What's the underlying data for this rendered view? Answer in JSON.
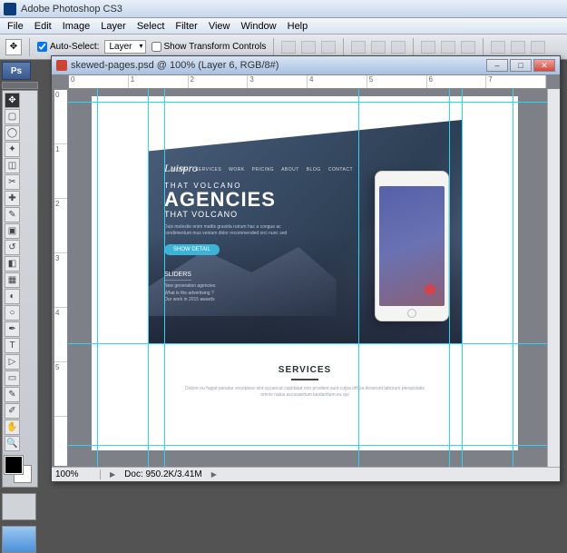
{
  "app": {
    "title": "Adobe Photoshop CS3"
  },
  "menu": [
    "File",
    "Edit",
    "Image",
    "Layer",
    "Select",
    "Filter",
    "View",
    "Window",
    "Help"
  ],
  "options": {
    "auto_select": "Auto-Select:",
    "auto_select_value": "Layer",
    "show_transform": "Show Transform Controls"
  },
  "doc": {
    "title": "skewed-pages.psd @ 100% (Layer 6, RGB/8#)",
    "zoom": "100%",
    "docsize": "Doc: 950.2K/3.41M"
  },
  "ruler_h": [
    "0",
    "1",
    "2",
    "3",
    "4",
    "5",
    "6",
    "7"
  ],
  "ruler_v": [
    "0",
    "1",
    "2",
    "3",
    "4",
    "5"
  ],
  "design": {
    "logo": "Luispro",
    "nav": [
      "HOME",
      "SERVICES",
      "WORK",
      "PRICING",
      "ABOUT",
      "BLOG",
      "CONTACT"
    ],
    "sup": "THAT VOLCANO",
    "headline": "AGENCIES",
    "sub": "THAT VOLCANO",
    "para": "Duis molestie enim mattis gravida rutrum hac a congue ac condimentum mus veniam dolor recommended orci nunc sed",
    "cta": "SHOW DETAIL",
    "sliders_title": "SLIDERS",
    "sliders_items": [
      "New generation agencies",
      "What is the advertising ?",
      "Our work in 2015 awards"
    ],
    "services_title": "SERVICES",
    "services_para": "Dolore eu fugiat pariatur excepteur sint occaecat cupidatat non proident sunt culpa officia deserunt laborum perspiciatis omnis natus accusantium laudantium eu qui"
  }
}
